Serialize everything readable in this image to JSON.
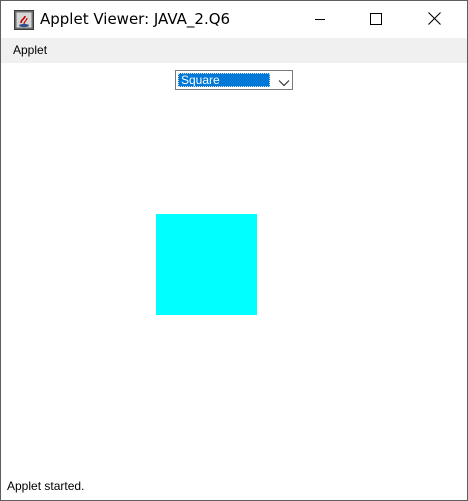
{
  "window": {
    "title": "Applet Viewer: JAVA_2.Q6",
    "icon": "java-applet-icon",
    "controls": {
      "minimize_icon": "minimize-icon",
      "maximize_icon": "maximize-icon",
      "close_icon": "close-icon"
    }
  },
  "menubar": {
    "items": [
      {
        "label": "Applet"
      }
    ]
  },
  "applet": {
    "shape_choice": {
      "selected": "Square",
      "arrow_icon": "chevron-down-icon"
    },
    "drawn_shape": {
      "kind": "square",
      "fill_color": "#00ffff"
    }
  },
  "status": {
    "text": "Applet started."
  },
  "colors": {
    "selection": "#0078d7",
    "menubar": "#f0f0f0",
    "shape_fill": "#00ffff"
  }
}
